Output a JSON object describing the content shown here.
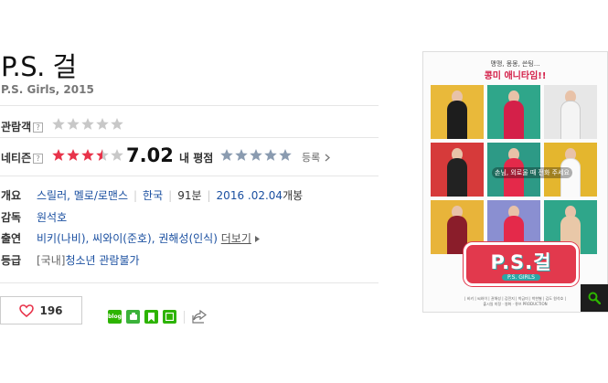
{
  "movie": {
    "title": "P.S. 걸",
    "subtitle": "P.S. Girls, 2015"
  },
  "ratings": {
    "audience_label": "관람객",
    "audience_score": 0,
    "netizen_label": "네티즌",
    "netizen_score": 7.02,
    "netizen_score_text": "7.02",
    "my_rating_label": "내 평점",
    "register_label": "등록",
    "help_mark": "?",
    "star_active_color": "#e8334a",
    "star_inactive_color": "#c8c8c8",
    "star_my_color": "#8a9bb0"
  },
  "info": {
    "overview_label": "개요",
    "genre": "스릴러, 멜로/로맨스",
    "country": "한국",
    "runtime": "91분",
    "release_date": "2016 .02.04",
    "release_suffix": "개봉",
    "director_label": "감독",
    "director": "원석호",
    "cast_label": "출연",
    "cast": "비키(나비), 씨와이(준호), 권해성(인식)",
    "more_label": "더보기",
    "rating_label": "등급",
    "grade_region": "[국내]",
    "grade": "청소년 관람불가"
  },
  "actions": {
    "like_count": "196"
  },
  "poster": {
    "tagline": "맹맹, 몽몽, 쓴팅...",
    "headline": "콩미 애니타임!!",
    "bubble": "손님, 외로울 때 전화 주세요",
    "logo": "P.S.걸",
    "logo_sub": "P.S. GIRLS",
    "credits_line1": "| 비키 | 씨와이 | 권해성 | 김민지 | 박금미 | 박한별 | 김도 원석호 |",
    "credits_line2": "출시일 미정 · 영화 · 큐브 PRODUCTION"
  },
  "icons": {
    "like": "heart-icon",
    "blog": "blog-icon",
    "band": "band-icon",
    "bookmark": "bookmark-icon",
    "memo": "memo-icon",
    "share": "share-icon",
    "zoom": "magnifier-icon"
  }
}
